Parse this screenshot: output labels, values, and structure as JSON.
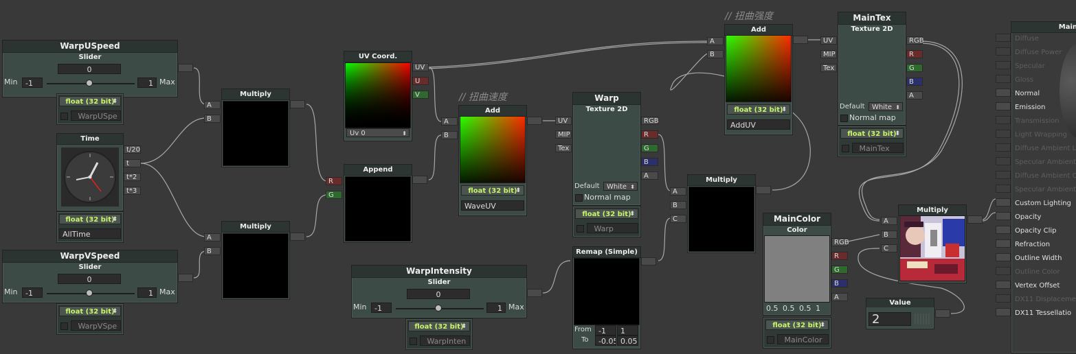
{
  "comments": {
    "add_uv": "// 扭曲强度",
    "add_wave": "// 扭曲速度"
  },
  "warp_u": {
    "title": "WarpUSpeed",
    "sub": "Slider",
    "value": "0",
    "min_label": "Min",
    "min": "-1",
    "max": "1",
    "max_label": "Max",
    "slider_fraction": 0.5,
    "precision": "float (32 bit)",
    "var": "_WarpUSpe"
  },
  "warp_v": {
    "title": "WarpVSpeed",
    "sub": "Slider",
    "value": "0",
    "min_label": "Min",
    "min": "-1",
    "max": "1",
    "max_label": "Max",
    "slider_fraction": 0.5,
    "precision": "float (32 bit)",
    "var": "_WarpVSpe"
  },
  "time": {
    "title": "Time",
    "outputs": [
      "t/20",
      "t",
      "t*2",
      "t*3"
    ],
    "precision": "float (32 bit)",
    "var": "AllTime"
  },
  "multiply1": {
    "title": "Multiply",
    "inputs": [
      "A",
      "B"
    ]
  },
  "multiply2": {
    "title": "Multiply",
    "inputs": [
      "A",
      "B"
    ]
  },
  "uv_coord": {
    "title": "UV Coord.",
    "outputs": [
      "UV",
      "U",
      "V"
    ],
    "channel": "Uv 0"
  },
  "append": {
    "title": "Append",
    "inputs": [
      "R",
      "G"
    ]
  },
  "add_wave": {
    "title": "Add",
    "inputs": [
      "A",
      "B"
    ],
    "precision": "float (32 bit)",
    "var": "WaveUV"
  },
  "warp_tex": {
    "title": "Warp",
    "sub": "Texture 2D",
    "inputs": [
      "UV",
      "MIP",
      "Tex"
    ],
    "outputs": [
      "RGB",
      "R",
      "G",
      "B",
      "A"
    ],
    "default_label": "Default",
    "default_value": "White",
    "normal_map": "Normal map",
    "precision": "float (32 bit)",
    "var": "_Warp"
  },
  "warp_intensity": {
    "title": "WarpIntensity",
    "sub": "Slider",
    "value": "0",
    "min_label": "Min",
    "min": "-1",
    "max": "1",
    "max_label": "Max",
    "slider_fraction": 0.5,
    "precision": "float (32 bit)",
    "var": "_WarpInten"
  },
  "remap": {
    "title": "Remap (Simple)",
    "from_label": "From",
    "from_a": "-1",
    "from_b": "1",
    "to_label": "To",
    "to_a": "-0.05",
    "to_b": "0.05"
  },
  "add_uv": {
    "title": "Add",
    "inputs": [
      "A",
      "B"
    ],
    "precision": "float (32 bit)",
    "var": "AddUV"
  },
  "multiply3": {
    "title": "Multiply",
    "inputs": [
      "A",
      "B",
      "C"
    ]
  },
  "main_tex": {
    "title": "MainTex",
    "sub": "Texture 2D",
    "inputs": [
      "UV",
      "MIP",
      "Tex"
    ],
    "outputs": [
      "RGB",
      "R",
      "G",
      "B",
      "A"
    ],
    "default_label": "Default",
    "default_value": "White",
    "normal_map": "Normal map",
    "precision": "float (32 bit)",
    "var": "_MainTex"
  },
  "main_color": {
    "title": "MainColor",
    "sub": "Color",
    "outputs": [
      "RGB",
      "R",
      "G",
      "B",
      "A"
    ],
    "rgba": [
      "0.5",
      "0.5",
      "0.5",
      "1"
    ],
    "swatch": "#808080",
    "precision": "float (32 bit)",
    "var": "_MainColor"
  },
  "multiply4": {
    "title": "Multiply",
    "inputs": [
      "A",
      "B",
      "C"
    ]
  },
  "value": {
    "title": "Value",
    "value": "2"
  },
  "main_panel": {
    "title": "Main",
    "props": [
      {
        "label": "Diffuse",
        "on": false
      },
      {
        "label": "Diffuse Power",
        "on": false
      },
      {
        "label": "Specular",
        "on": false
      },
      {
        "label": "Gloss",
        "on": false
      },
      {
        "label": "Normal",
        "on": true
      },
      {
        "label": "Emission",
        "on": true
      },
      {
        "label": "Transmission",
        "on": false
      },
      {
        "label": "Light Wrapping",
        "on": false
      },
      {
        "label": "Diffuse Ambient L",
        "on": false
      },
      {
        "label": "Specular Ambient",
        "on": false
      },
      {
        "label": "Diffuse Ambient O",
        "on": false
      },
      {
        "label": "Specular Ambient",
        "on": false
      },
      {
        "label": "Custom Lighting",
        "on": true
      },
      {
        "label": "Opacity",
        "on": true
      },
      {
        "label": "Opacity Clip",
        "on": true
      },
      {
        "label": "Refraction",
        "on": true
      },
      {
        "label": "Outline Width",
        "on": true
      },
      {
        "label": "Outline Color",
        "on": false
      },
      {
        "label": "Vertex Offset",
        "on": true
      },
      {
        "label": "DX11 Displaceme",
        "on": false
      },
      {
        "label": "DX11 Tessellatio",
        "on": true
      }
    ]
  },
  "colors": {
    "canvas": "#393939",
    "node": "#3c4b45",
    "precision": "#c8f56a",
    "wire": "#9a9a9a"
  }
}
